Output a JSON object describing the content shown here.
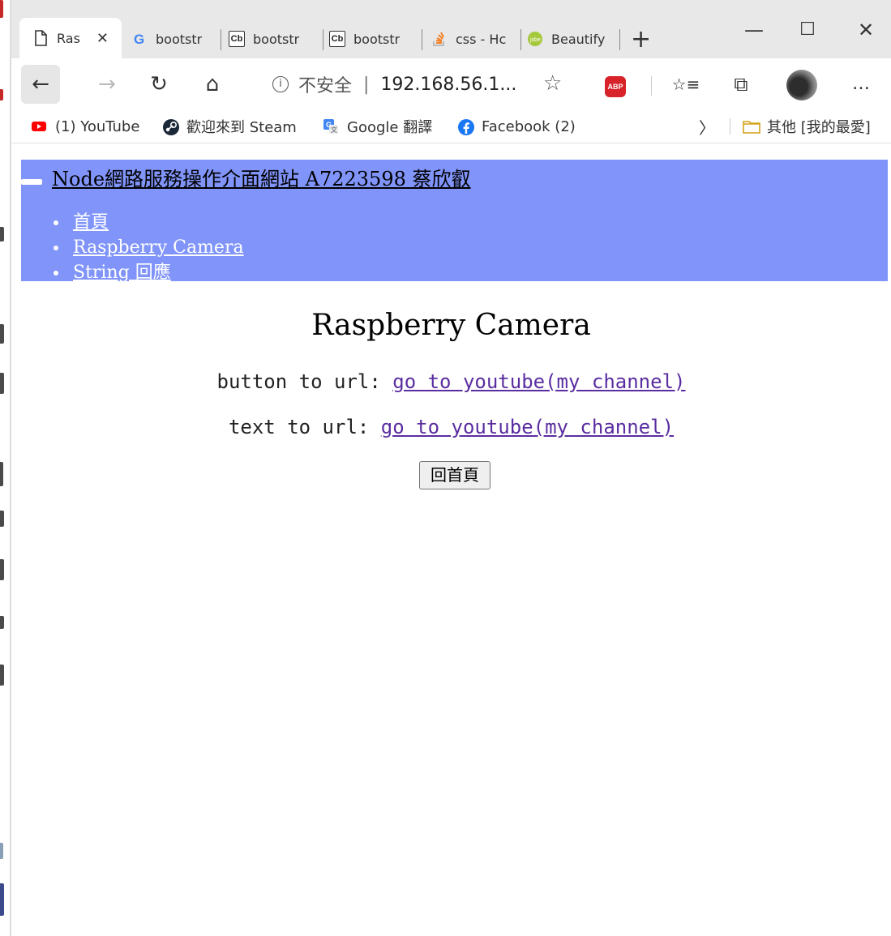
{
  "tabs": [
    {
      "label": "Ras",
      "active": true,
      "icon": "page-icon"
    },
    {
      "label": "bootstr",
      "icon": "google-icon"
    },
    {
      "label": "bootstr",
      "icon": "codebeautify-icon"
    },
    {
      "label": "bootstr",
      "icon": "codebeautify-icon"
    },
    {
      "label": "css - Hc",
      "icon": "stackoverflow-icon"
    },
    {
      "label": "Beautify",
      "icon": "jsbeautify-icon"
    }
  ],
  "tab_close_glyph": "✕",
  "new_tab_glyph": "+",
  "window_controls": {
    "minimize": "—",
    "maximize": "☐",
    "close": "✕"
  },
  "toolbar": {
    "back": "←",
    "forward": "→",
    "refresh": "↻",
    "home": "⌂",
    "favorites": "☆",
    "reading_list": "☆≡",
    "collections": "⧉",
    "more": "…",
    "abp_label": "ABP"
  },
  "address": {
    "info_glyph": "i",
    "security_text": "不安全",
    "separator": "|",
    "url": "192.168.56.1..."
  },
  "bookmarks": [
    {
      "label": "(1) YouTube",
      "icon": "youtube-icon",
      "color": "#ff0000"
    },
    {
      "label": "歡迎來到 Steam",
      "icon": "steam-icon",
      "color": "#1b2838"
    },
    {
      "label": "Google 翻譯",
      "icon": "google-translate-icon",
      "color": "#4285f4"
    },
    {
      "label": "Facebook (2)",
      "icon": "facebook-icon",
      "color": "#1877f2"
    }
  ],
  "bookmarks_more": "〉",
  "other_favorites": "其他 [我的最愛]",
  "site": {
    "header_color": "#8094f9",
    "title": "Node網路服務操作介面網站 A7223598 蔡欣叡",
    "nav": [
      "首頁",
      "Raspberry Camera",
      "String 回應"
    ]
  },
  "main": {
    "heading": "Raspberry Camera",
    "line1_label": "button to url: ",
    "line1_link": "go to youtube(my channel)",
    "line2_label": "text to url: ",
    "line2_link": "go to youtube(my channel)",
    "home_button": "回首頁"
  }
}
